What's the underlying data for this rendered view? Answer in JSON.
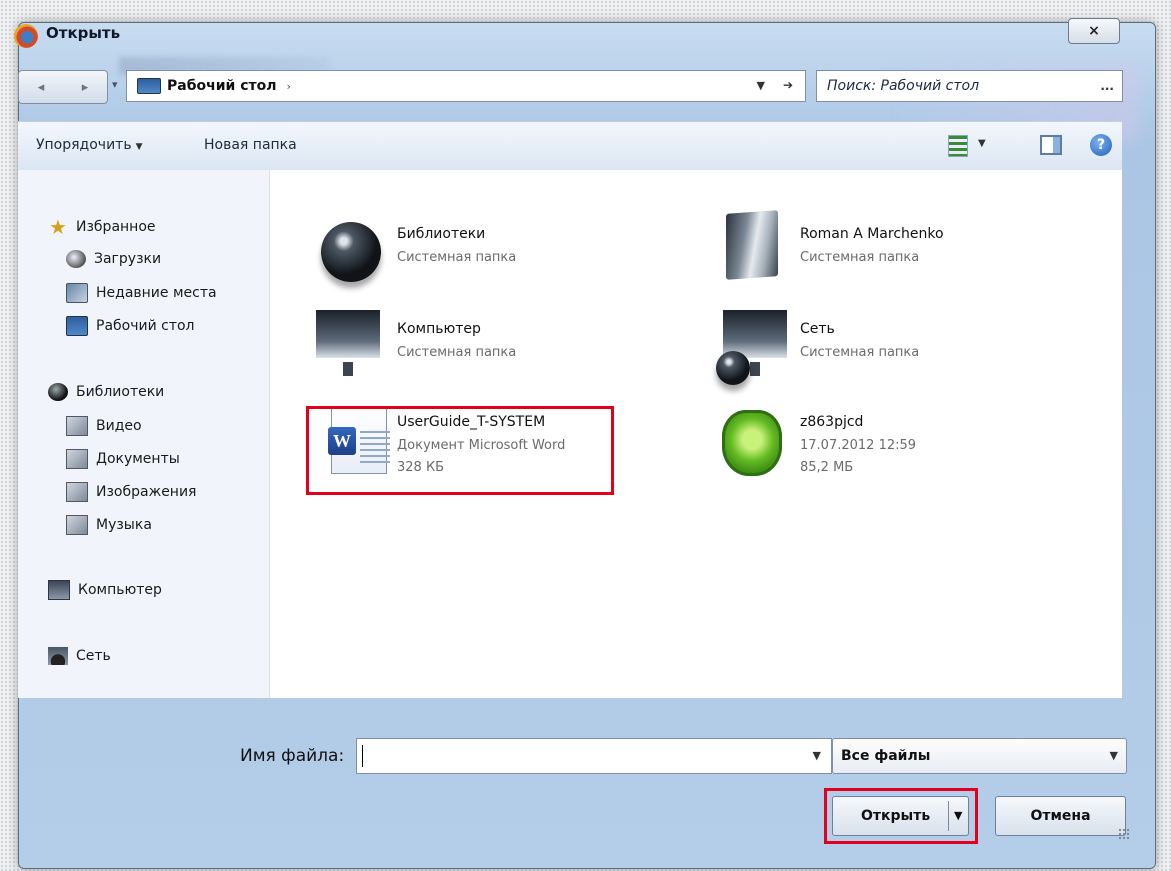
{
  "dialog": {
    "title": "Открыть",
    "close_label": "×"
  },
  "navigation": {
    "back_icon": "back-arrow-icon",
    "forward_icon": "forward-arrow-icon",
    "address": "Рабочий стол",
    "search_placeholder": "Поиск: Рабочий стол",
    "search_more": "..."
  },
  "toolbar": {
    "organize_label": "Упорядочить",
    "new_folder_label": "Новая папка"
  },
  "sidebar": {
    "favorites": {
      "label": "Избранное",
      "items": [
        "Загрузки",
        "Недавние места",
        "Рабочий стол"
      ]
    },
    "libraries": {
      "label": "Библиотеки",
      "items": [
        "Видео",
        "Документы",
        "Изображения",
        "Музыка"
      ]
    },
    "computer_label": "Компьютер",
    "network_label": "Сеть"
  },
  "files": [
    {
      "name": "Библиотеки",
      "line2": "Системная папка",
      "line3": "",
      "icon": "libraries-icon"
    },
    {
      "name": "Roman A Marchenko",
      "line2": "Системная папка",
      "line3": "",
      "icon": "user-folder-icon"
    },
    {
      "name": "Компьютер",
      "line2": "Системная папка",
      "line3": "",
      "icon": "computer-icon"
    },
    {
      "name": "Сеть",
      "line2": "Системная папка",
      "line3": "",
      "icon": "network-icon"
    },
    {
      "name": "UserGuide_T-SYSTEM",
      "line2": "Документ Microsoft Word",
      "line3": "328 КБ",
      "icon": "word-document-icon"
    },
    {
      "name": "z863pjcd",
      "line2": "17.07.2012 12:59",
      "line3": "85,2 МБ",
      "icon": "drweb-shield-icon"
    }
  ],
  "bottom": {
    "filename_label": "Имя файла:",
    "filename_value": "",
    "file_type": "Все файлы",
    "open_label": "Открыть",
    "cancel_label": "Отмена"
  },
  "colors": {
    "highlight": "#e3001b",
    "chrome": "#b9d1ea"
  }
}
